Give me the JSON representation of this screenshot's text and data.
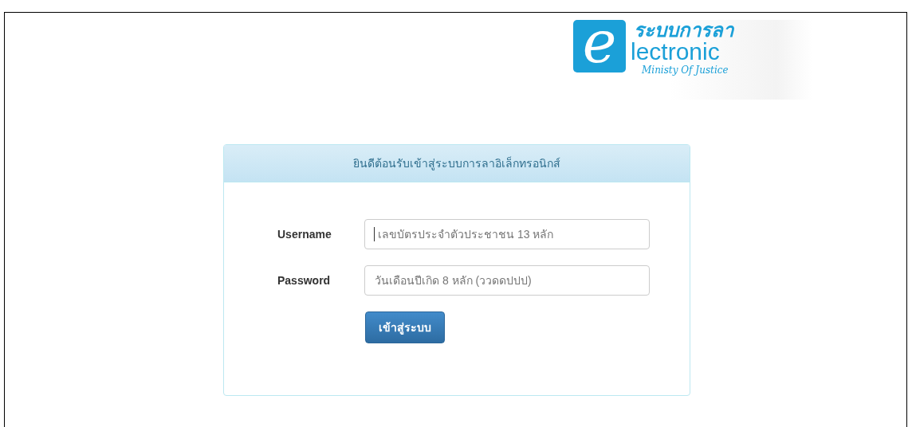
{
  "logo": {
    "mark": "e",
    "title": "ระบบการลา",
    "word": "lectronic",
    "subtitle": "Ministy Of Justice"
  },
  "login_panel": {
    "heading": "ยินดีต้อนรับเข้าสู่ระบบการลาอิเล็กทรอนิกส์",
    "fields": [
      {
        "label": "Username",
        "placeholder": "เลขบัตรประจำตัวประชาชน 13 หลัก",
        "focused": true
      },
      {
        "label": "Password",
        "placeholder": "วันเดือนปีเกิด 8 หลัก (ววดดปปป)",
        "focused": false
      }
    ],
    "button": "เข้าสู่ระบบ"
  }
}
